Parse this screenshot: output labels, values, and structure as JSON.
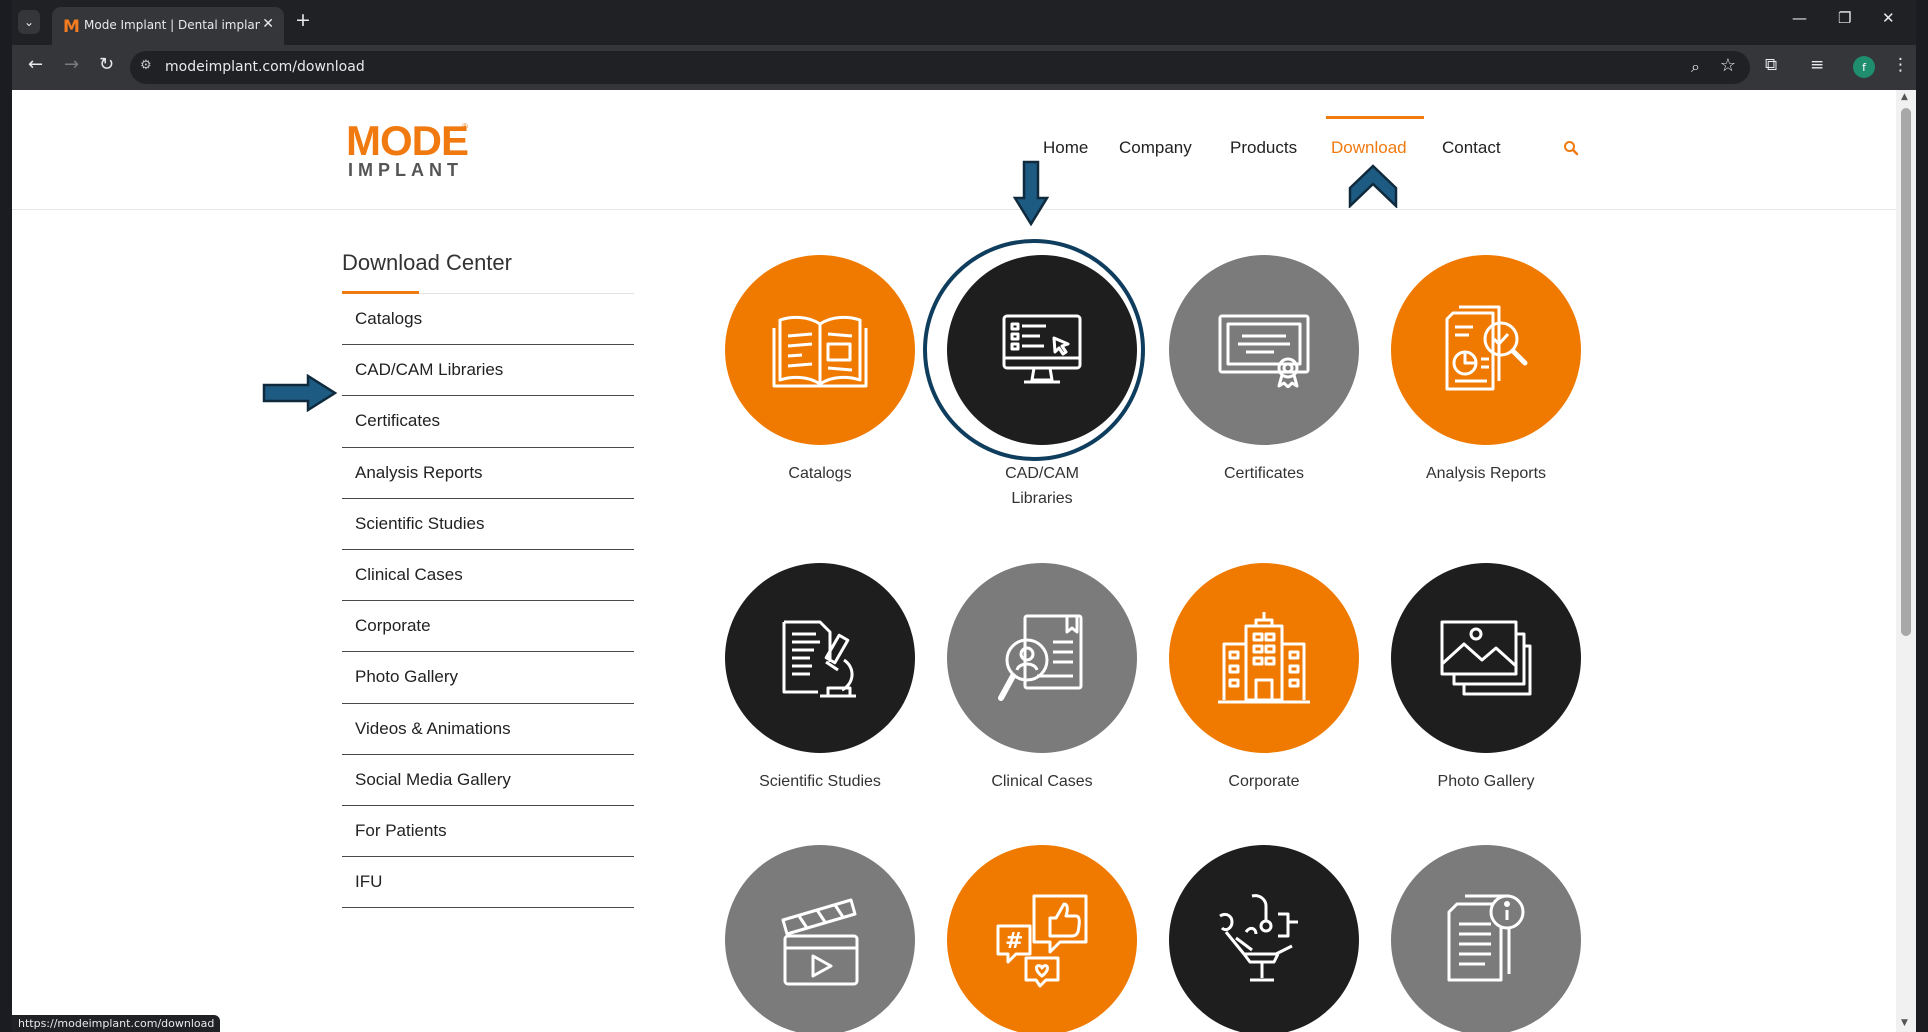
{
  "browser": {
    "tab_title": "Mode Implant | Dental implant",
    "tab_favicon": "M",
    "url": "modeimplant.com/download",
    "status_url": "https://modeimplant.com/download",
    "profile_initial": "f"
  },
  "site": {
    "logo_mode": "MODE",
    "logo_implant": "IMPLANT",
    "logo_reg": "®",
    "nav": [
      "Home",
      "Company",
      "Products",
      "Download",
      "Contact"
    ],
    "active_nav": "Download",
    "accent_color": "#f07a10"
  },
  "sidebar": {
    "heading": "Download Center",
    "items": [
      "Catalogs",
      "CAD/CAM Libraries",
      "Certificates",
      "Analysis Reports",
      "Scientific Studies",
      "Clinical Cases",
      "Corporate",
      "Photo Gallery",
      "Videos & Animations",
      "Social Media Gallery",
      "For Patients",
      "IFU"
    ]
  },
  "grid": {
    "items": [
      {
        "label": "Catalogs",
        "color": "orange",
        "icon": "book-icon"
      },
      {
        "label": "CAD/CAM Libraries",
        "color": "black",
        "icon": "monitor-icon"
      },
      {
        "label": "Certificates",
        "color": "gray",
        "icon": "certificate-icon"
      },
      {
        "label": "Analysis Reports",
        "color": "orange",
        "icon": "report-search-icon"
      },
      {
        "label": "Scientific Studies",
        "color": "black",
        "icon": "microscope-icon"
      },
      {
        "label": "Clinical Cases",
        "color": "gray",
        "icon": "case-file-icon"
      },
      {
        "label": "Corporate",
        "color": "orange",
        "icon": "building-icon"
      },
      {
        "label": "Photo Gallery",
        "color": "black",
        "icon": "gallery-icon"
      },
      {
        "label": "",
        "color": "gray",
        "icon": "clapperboard-icon"
      },
      {
        "label": "",
        "color": "orange",
        "icon": "social-media-icon"
      },
      {
        "label": "",
        "color": "black",
        "icon": "dental-chair-icon"
      },
      {
        "label": "",
        "color": "gray",
        "icon": "info-document-icon"
      }
    ]
  }
}
